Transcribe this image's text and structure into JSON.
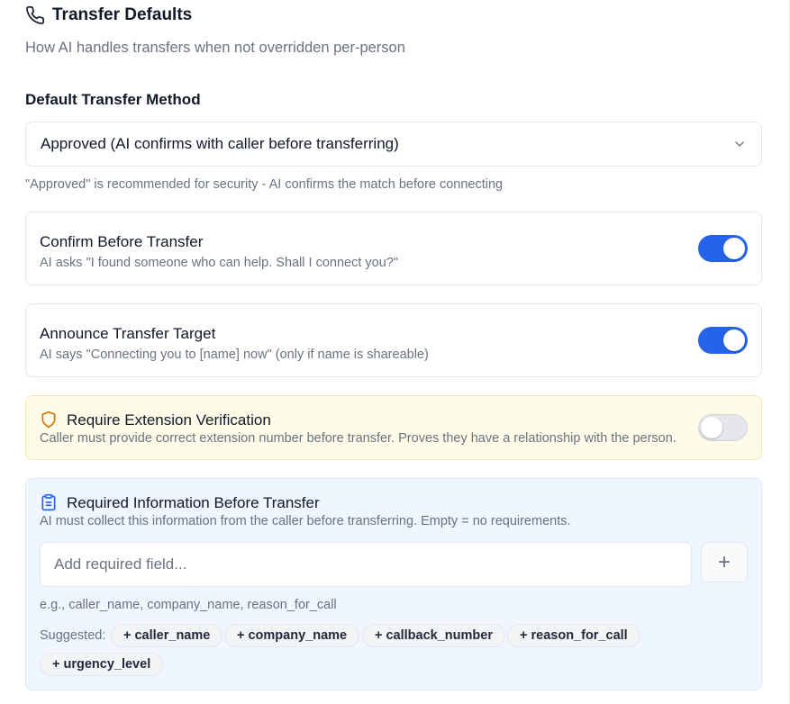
{
  "header": {
    "title": "Transfer Defaults",
    "subtitle": "How AI handles transfers when not overridden per-person",
    "icon": "phone-icon"
  },
  "method": {
    "label": "Default Transfer Method",
    "selected": "Approved (AI confirms with caller before transferring)",
    "hint": "\"Approved\" is recommended for security - AI confirms the match before connecting"
  },
  "confirm_before_transfer": {
    "title": "Confirm Before Transfer",
    "description": "AI asks \"I found someone who can help. Shall I connect you?\"",
    "enabled": true
  },
  "announce_target": {
    "title": "Announce Transfer Target",
    "description": "AI says \"Connecting you to [name] now\" (only if name is shareable)",
    "enabled": true
  },
  "extension_verification": {
    "title": "Require Extension Verification",
    "description": "Caller must provide correct extension number before transfer. Proves they have a relationship with the person.",
    "enabled": false,
    "icon": "shield-icon"
  },
  "required_info": {
    "title": "Required Information Before Transfer",
    "description": "AI must collect this information from the caller before transferring. Empty = no requirements.",
    "icon": "clipboard-icon",
    "input_placeholder": "Add required field...",
    "input_value": "",
    "add_label": "+",
    "example": "e.g., caller_name, company_name, reason_for_call",
    "suggested_label": "Suggested:",
    "suggestions": [
      "+ caller_name",
      "+ company_name",
      "+ callback_number",
      "+ reason_for_call",
      "+ urgency_level"
    ]
  },
  "colors": {
    "accent": "#2563eb",
    "warning_bg": "#fefce8",
    "warning_icon": "#d97706",
    "info_bg": "#eff6ff",
    "info_icon": "#2563eb"
  }
}
